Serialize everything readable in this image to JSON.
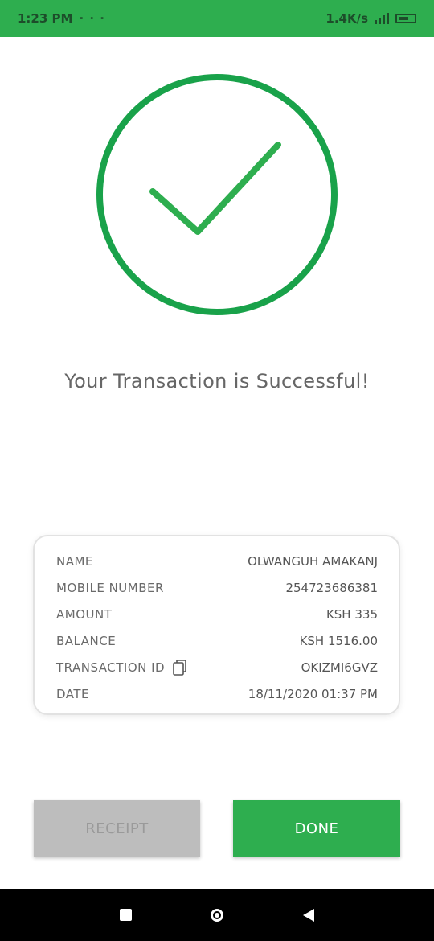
{
  "status_bar": {
    "time": "1:23 PM",
    "extra": "· · ·",
    "battery_text": "1.4K/s"
  },
  "headline": "Your Transaction is Successful!",
  "details": [
    {
      "label": "NAME",
      "value": "OLWANGUH AMAKANJ"
    },
    {
      "label": "MOBILE NUMBER",
      "value": "254723686381"
    },
    {
      "label": "AMOUNT",
      "value": "KSH 335"
    },
    {
      "label": "BALANCE",
      "value": "KSH 1516.00"
    },
    {
      "label": "TRANSACTION ID",
      "value": "OKIZMI6GVZ"
    },
    {
      "label": "DATE",
      "value": "18/11/2020 01:37 PM"
    }
  ],
  "buttons": {
    "secondary": "RECEIPT",
    "primary": "DONE"
  },
  "colors": {
    "accent": "#2eae4f",
    "check_ring": "#19a24a"
  }
}
